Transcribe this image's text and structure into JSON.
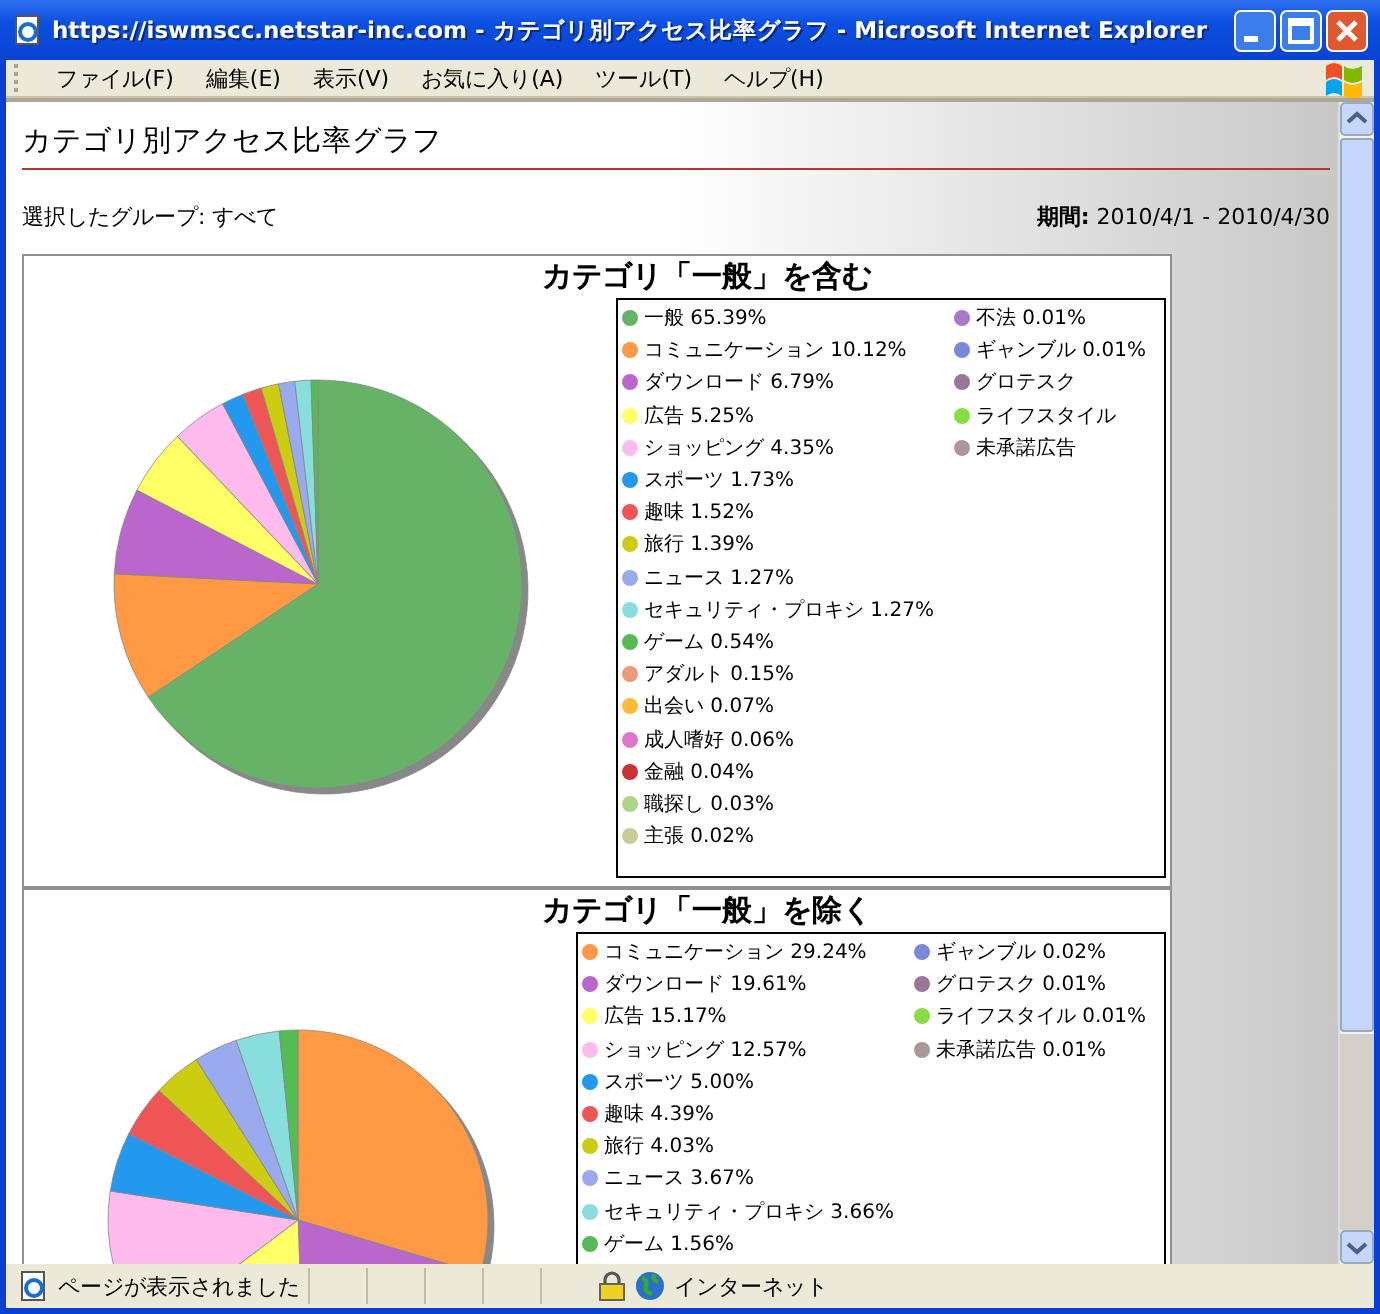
{
  "window": {
    "title": "https://iswmscc.netstar-inc.com - カテゴリ別アクセス比率グラフ - Microsoft Internet Explorer"
  },
  "menu": [
    "ファイル(F)",
    "編集(E)",
    "表示(V)",
    "お気に入り(A)",
    "ツール(T)",
    "ヘルプ(H)"
  ],
  "page": {
    "title": "カテゴリ別アクセス比率グラフ",
    "group": "選択したグループ: すべて",
    "period": "**期間:** 2010/4/1 - 2010/4/30"
  },
  "charts": [
    {
      "title": "カテゴリ「一般」を含む",
      "legend_column_1": [
        {
          "label": "一般 65.39%",
          "color": "#66b266"
        },
        {
          "label": "コミュニケーション 10.12%",
          "color": "#ff9944"
        },
        {
          "label": "ダウンロード 6.79%",
          "color": "#bb66cc"
        },
        {
          "label": "広告 5.25%",
          "color": "#ffff66"
        },
        {
          "label": "ショッピング 4.35%",
          "color": "#ffbbee"
        },
        {
          "label": "スポーツ 1.73%",
          "color": "#2299ee"
        },
        {
          "label": "趣味 1.52%",
          "color": "#ee5555"
        },
        {
          "label": "旅行 1.39%",
          "color": "#cccc11"
        },
        {
          "label": "ニュース 1.27%",
          "color": "#99aaee"
        },
        {
          "label": "セキュリティ・プロキシ 1.27%",
          "color": "#88dddd"
        },
        {
          "label": "ゲーム 0.54%",
          "color": "#55bb55"
        },
        {
          "label": "アダルト 0.15%",
          "color": "#ee9977"
        },
        {
          "label": "出会い 0.07%",
          "color": "#ffbb33"
        },
        {
          "label": "成人嗜好 0.06%",
          "color": "#dd77cc"
        },
        {
          "label": "金融 0.04%",
          "color": "#cc3333"
        },
        {
          "label": "職探し 0.03%",
          "color": "#aad688"
        },
        {
          "label": "主張 0.02%",
          "color": "#cccc99"
        }
      ],
      "legend_column_2": [
        {
          "label": "不法 0.01%",
          "color": "#aa77cc"
        },
        {
          "label": "ギャンブル 0.01%",
          "color": "#7788dd"
        },
        {
          "label": "グロテスク",
          "color": "#997799"
        },
        {
          "label": "ライフスタイル",
          "color": "#88dd44"
        },
        {
          "label": "未承諾広告",
          "color": "#aa9999"
        }
      ],
      "chart_data": {
        "type": "pie",
        "values": [
          65.39,
          10.12,
          6.79,
          5.25,
          4.35,
          1.73,
          1.52,
          1.39,
          1.27,
          1.27,
          0.54
        ]
      }
    },
    {
      "title": "カテゴリ「一般」を除く",
      "legend_column_1": [
        {
          "label": "コミュニケーション 29.24%",
          "color": "#ff9944"
        },
        {
          "label": "ダウンロード 19.61%",
          "color": "#bb66cc"
        },
        {
          "label": "広告 15.17%",
          "color": "#ffff66"
        },
        {
          "label": "ショッピング 12.57%",
          "color": "#ffbbee"
        },
        {
          "label": "スポーツ 5.00%",
          "color": "#2299ee"
        },
        {
          "label": "趣味 4.39%",
          "color": "#ee5555"
        },
        {
          "label": "旅行 4.03%",
          "color": "#cccc11"
        },
        {
          "label": "ニュース 3.67%",
          "color": "#99aaee"
        },
        {
          "label": "セキュリティ・プロキシ 3.66%",
          "color": "#88dddd"
        },
        {
          "label": "ゲーム 1.56%",
          "color": "#55bb55"
        }
      ],
      "legend_column_2": [
        {
          "label": "ギャンブル 0.02%",
          "color": "#7788dd"
        },
        {
          "label": "グロテスク 0.01%",
          "color": "#997799"
        },
        {
          "label": "ライフスタイル 0.01%",
          "color": "#88dd44"
        },
        {
          "label": "未承諾広告 0.01%",
          "color": "#aa9999"
        }
      ],
      "chart_data": {
        "type": "pie",
        "values": [
          29.24,
          19.61,
          15.17,
          12.57,
          5.0,
          4.39,
          4.03,
          3.67,
          3.66,
          1.56
        ]
      }
    }
  ],
  "status_bar": {
    "text": "ページが表示されました",
    "zone": "インターネット"
  }
}
